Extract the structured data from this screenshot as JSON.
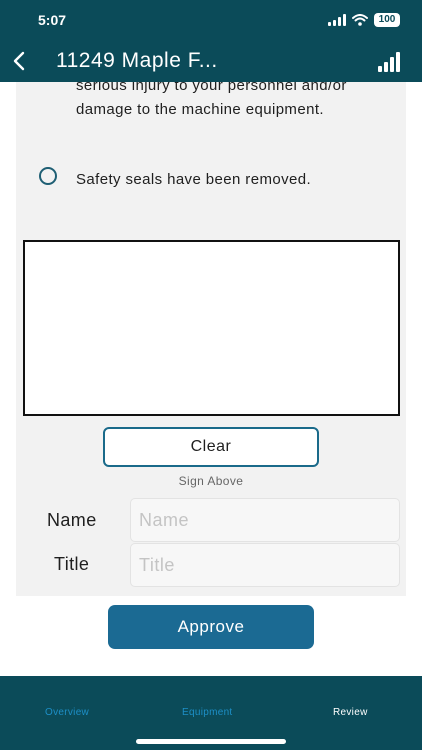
{
  "status_bar": {
    "time": "5:07",
    "battery": "100",
    "icons": [
      "cellular-signal-icon",
      "wifi-icon",
      "battery-icon"
    ]
  },
  "nav": {
    "back_icon": "chevron-left-icon",
    "title": "11249 Maple F...",
    "right_icon": "signal-bars-icon"
  },
  "warning": {
    "text_line1": "serious injury to your personnel and/or",
    "text_line2": "damage to the machine equipment."
  },
  "checklist": {
    "item_label": "Safety seals have been removed."
  },
  "signature": {
    "clear_label": "Clear",
    "hint": "Sign Above"
  },
  "form": {
    "name_label": "Name",
    "name_placeholder": "Name",
    "name_value": "",
    "title_label": "Title",
    "title_placeholder": "Title",
    "title_value": ""
  },
  "actions": {
    "approve_label": "Approve"
  },
  "tabs": {
    "overview": "Overview",
    "equipment": "Equipment",
    "review": "Review"
  },
  "colors": {
    "header_bg": "#0b4b59",
    "accent": "#1b6a93",
    "tab_inactive": "#1d8fc7"
  }
}
